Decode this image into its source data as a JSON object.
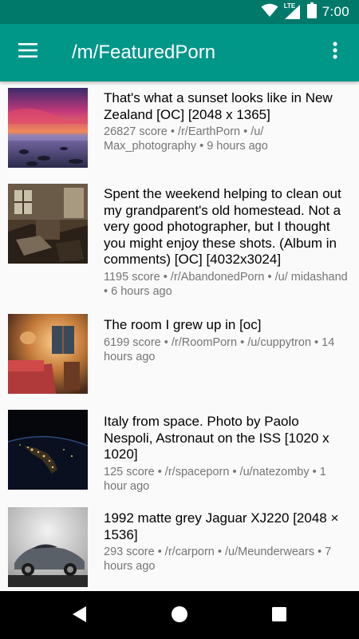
{
  "status_bar": {
    "time": "7:00",
    "network_label": "LTE",
    "icons": [
      "wifi-icon",
      "lte-signal-icon",
      "battery-icon"
    ]
  },
  "app_bar": {
    "title": "/m/FeaturedPorn",
    "menu_icon": "hamburger-menu-icon",
    "overflow_icon": "more-vert-icon"
  },
  "colors": {
    "status_bar": "#00796b",
    "app_bar": "#009688",
    "background": "#fafafa",
    "meta_text": "#757575"
  },
  "posts": [
    {
      "title": "That's what a sunset looks like in New Zealand [OC] [2048 x 1365]",
      "meta": "26827 score • /r/EarthPorn • /u/ Max_photography • 9 hours ago",
      "thumbnail": "sunset-coast-thumbnail"
    },
    {
      "title": "Spent the weekend helping to clean out my grandparent's old homestead. Not a very good photographer, but I thought you might enjoy these shots. (Album in comments) [OC] [4032x3024]",
      "meta": "1195 score • /r/AbandonedPorn • /u/ midashand • 6 hours ago",
      "thumbnail": "abandoned-room-thumbnail"
    },
    {
      "title": "The room I grew up in [oc]",
      "meta": "6199 score • /r/RoomPorn • /u/cuppytron • 14 hours ago",
      "thumbnail": "bedroom-thumbnail"
    },
    {
      "title": "Italy from space. Photo by Paolo Nespoli, Astronaut on the ISS [1020 x 1020]",
      "meta": "125 score • /r/spaceporn • /u/natezomby • 1 hour ago",
      "thumbnail": "italy-night-space-thumbnail"
    },
    {
      "title": "1992 matte grey Jaguar XJ220 [2048 × 1536]",
      "meta": "293 score • /r/carporn • /u/Meunderwears • 7 hours ago",
      "thumbnail": "jaguar-car-thumbnail"
    }
  ],
  "nav_bar": {
    "buttons": [
      "back-icon",
      "home-icon",
      "recents-icon"
    ]
  }
}
